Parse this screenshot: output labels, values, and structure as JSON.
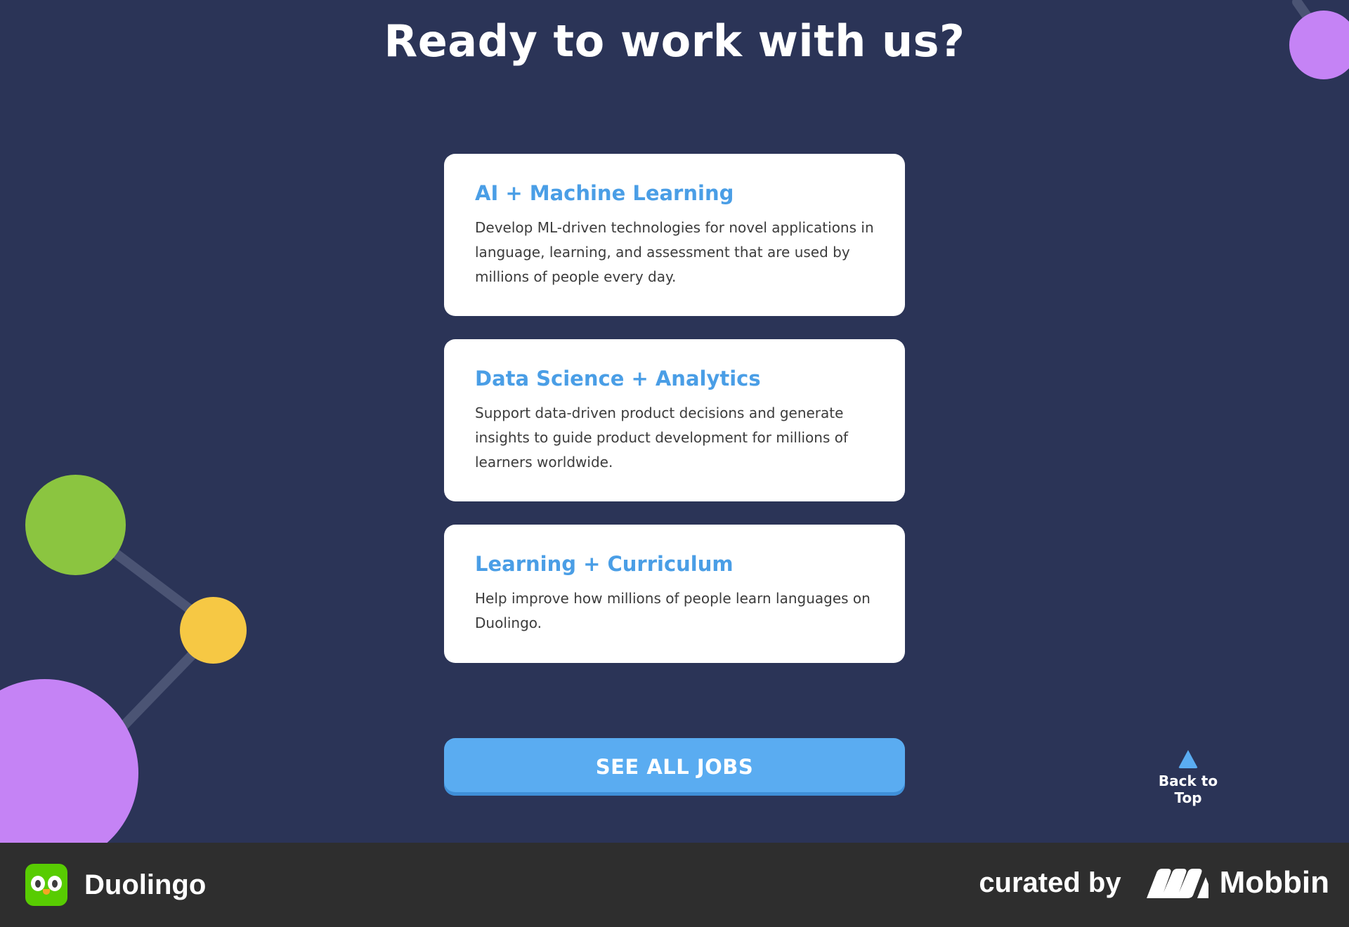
{
  "hero": {
    "headline": "Ready to work with us?"
  },
  "cards": [
    {
      "title": "AI + Machine Learning",
      "description": "Develop ML-driven technologies for novel applications in language, learning, and assessment that are used by millions of people every day."
    },
    {
      "title": "Data Science + Analytics",
      "description": "Support data-driven product decisions and generate insights to guide product development for millions of learners worldwide."
    },
    {
      "title": "Learning + Curriculum",
      "description": "Help improve how millions of people learn languages on Duolingo."
    }
  ],
  "cta": {
    "label": "SEE ALL JOBS"
  },
  "back_to_top": {
    "label": "Back to Top",
    "icon": "triangle-up-icon"
  },
  "footer": {
    "app_name": "Duolingo",
    "curated_by": "curated by",
    "curator_name": "Mobbin"
  },
  "colors": {
    "background": "#2b3457",
    "card_title": "#4a9ee6",
    "cta": "#5aacf1",
    "green": "#8bc540",
    "yellow": "#f6c844",
    "purple": "#c583f5",
    "footer": "#2e2e2e"
  }
}
